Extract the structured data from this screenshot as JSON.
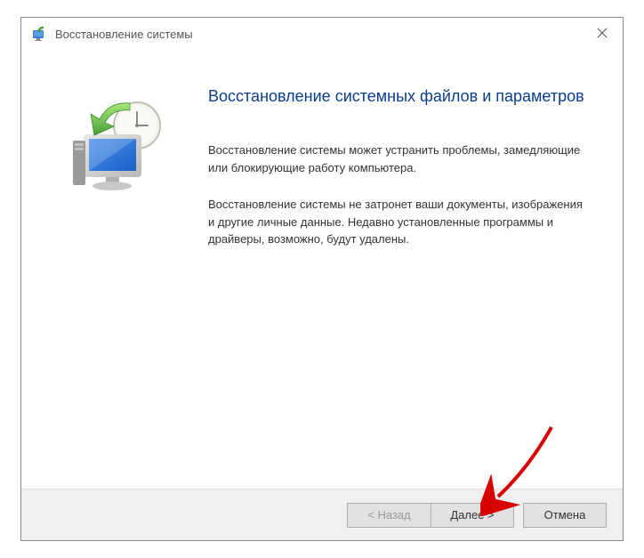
{
  "window": {
    "title": "Восстановление системы"
  },
  "content": {
    "heading": "Восстановление системных файлов и параметров",
    "paragraph1": "Восстановление системы может устранить проблемы, замедляющие или блокирующие работу компьютера.",
    "paragraph2": "Восстановление системы не затронет ваши документы, изображения и другие личные данные. Недавно установленные программы и драйверы, возможно, будут удалены."
  },
  "buttons": {
    "back": "< Назад",
    "next": "Далее >",
    "cancel": "Отмена"
  }
}
